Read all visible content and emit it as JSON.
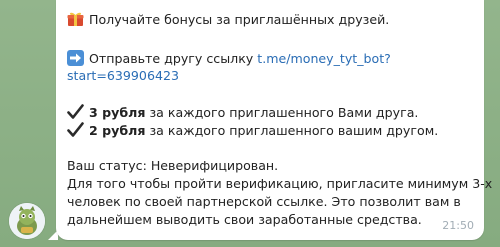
{
  "message": {
    "line1_text": "Получайте бонусы за приглашённых друзей.",
    "line2_prefix": "Отправьте другу ссылку ",
    "link_part1": "t.me/money_tyt_bot?",
    "link_part2": "start=639906423",
    "bullet1_bold": "3 рубля",
    "bullet1_rest": " за каждого приглашенного Вами друга.",
    "bullet2_bold": "2 рубля",
    "bullet2_rest": " за каждого приглашенного вашим другом.",
    "status": "Ваш статус: Неверифицирован.",
    "info_line1": "Для того чтобы пройти верификацию, пригласите минимум 3-х",
    "info_line2": "человек по своей партнерской ссылке. Это позволит вам в",
    "info_line3": "дальнейшем выводить свои заработанные средства.",
    "time": "21:50"
  },
  "icons": {
    "line1": "gift-icon",
    "line2": "arrow-right-icon",
    "bullet1": "check-mark-icon",
    "bullet2": "check-mark-icon",
    "avatar": "bot-avatar-icon"
  },
  "colors": {
    "link": "#2a6db5",
    "timestamp": "#a2adb5",
    "bubble": "#ffffff",
    "chat_background": "#8fb28a"
  }
}
